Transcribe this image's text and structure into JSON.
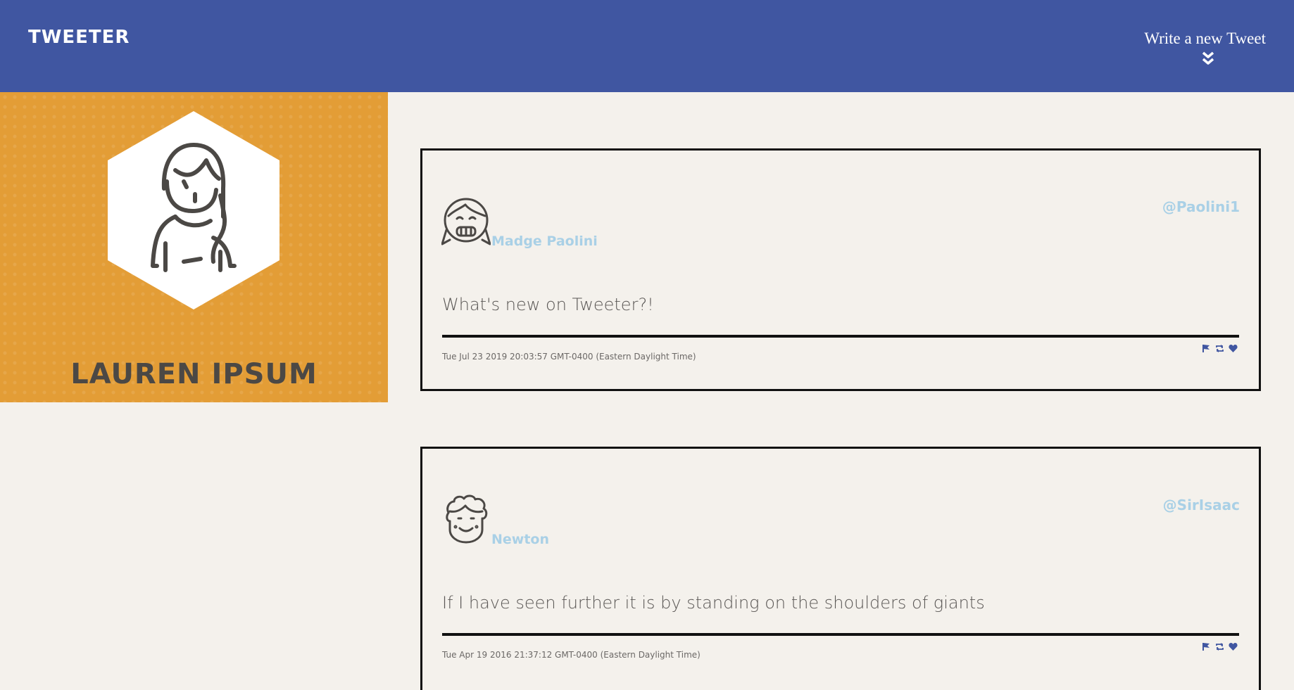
{
  "header": {
    "logo": "TWEETER",
    "compose_label": "Write a new Tweet",
    "compose_icon": "double-chevron-down-icon"
  },
  "profile": {
    "name": "LAUREN IPSUM",
    "avatar_icon": "woman-avatar-icon"
  },
  "tweets": [
    {
      "name": "Madge Paolini",
      "handle": "@Paolini1",
      "text": "What's new on Tweeter?!",
      "timestamp": "Tue Jul 23 2019 20:03:57 GMT-0400 (Eastern Daylight Time)",
      "avatar_icon": "girl-avatar-icon"
    },
    {
      "name": "Newton",
      "handle": "@SirIsaac",
      "text": "If I have seen further it is by standing on the shoulders of giants",
      "timestamp": "Tue Apr 19 2016 21:37:12 GMT-0400 (Eastern Daylight Time)",
      "avatar_icon": "curly-hair-avatar-icon"
    }
  ],
  "actions": [
    "flag-icon",
    "retweet-icon",
    "heart-icon"
  ],
  "colors": {
    "header": "#4056a1",
    "profile": "#e39d36",
    "background": "#f4f1ec",
    "handle": "#a9d0e6",
    "icon": "#4056a1"
  }
}
